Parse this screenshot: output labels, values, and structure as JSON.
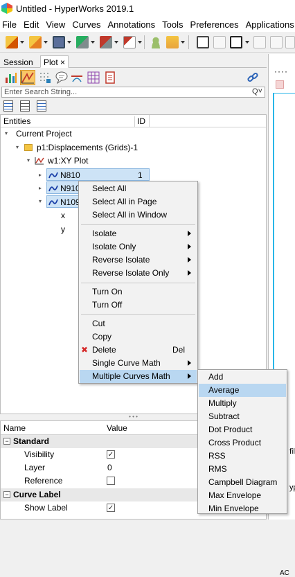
{
  "window": {
    "title": "Untitled - HyperWorks 2019.1"
  },
  "menubar": [
    "File",
    "Edit",
    "View",
    "Curves",
    "Annotations",
    "Tools",
    "Preferences",
    "Applications"
  ],
  "toolbar": {
    "icons": [
      "open-session-icon",
      "open-model-icon",
      "save-icon",
      "export-icon",
      "publish-icon",
      "ppt-export-icon",
      "user-icon",
      "folder-icon",
      "add-page-icon",
      "delete-page-icon",
      "page-layout-icon",
      "window-icon",
      "sync-icon"
    ]
  },
  "panel": {
    "tabs": [
      {
        "label": "Session"
      },
      {
        "label": "Plot"
      }
    ],
    "close_glyph": "×",
    "search_placeholder": "Enter Search String...",
    "search_glyph": "Q˅"
  },
  "entities": {
    "columns": [
      "Entities",
      "ID"
    ],
    "tree": {
      "project": "Current Project",
      "page": "p1:Displacements (Grids)-1",
      "window": "w1:XY Plot",
      "curves": [
        {
          "label": "N810",
          "id": "1"
        },
        {
          "label": "N910",
          "id": ""
        },
        {
          "label": "N109",
          "id": ""
        }
      ],
      "axes": [
        "x",
        "y"
      ]
    }
  },
  "context_menu": {
    "groups": [
      [
        {
          "label": "Select All"
        },
        {
          "label": "Select All in Page"
        },
        {
          "label": "Select All in Window"
        }
      ],
      [
        {
          "label": "Isolate",
          "submenu": true
        },
        {
          "label": "Isolate Only",
          "submenu": true
        },
        {
          "label": "Reverse Isolate",
          "submenu": true
        },
        {
          "label": "Reverse Isolate Only",
          "submenu": true
        }
      ],
      [
        {
          "label": "Turn On"
        },
        {
          "label": "Turn Off"
        }
      ],
      [
        {
          "label": "Cut"
        },
        {
          "label": "Copy"
        },
        {
          "label": "Delete",
          "shortcut": "Del",
          "icon": "✖"
        },
        {
          "label": "Single Curve Math",
          "submenu": true
        },
        {
          "label": "Multiple Curves Math",
          "submenu": true,
          "highlighted": true
        }
      ]
    ]
  },
  "submenu": {
    "items": [
      "Add",
      "Average",
      "Multiply",
      "Subtract",
      "Dot Product",
      "Cross Product",
      "RSS",
      "RMS",
      "Campbell Diagram",
      "Max Envelope",
      "Min Envelope"
    ],
    "highlighted": "Average"
  },
  "splitter_glyph": "• • •",
  "properties": {
    "columns": [
      "Name",
      "Value"
    ],
    "sections": [
      {
        "title": "Standard",
        "rows": [
          {
            "name": "Visibility",
            "type": "checkbox",
            "checked": true,
            "value": "✓"
          },
          {
            "name": "Layer",
            "type": "text",
            "value": "0"
          },
          {
            "name": "Reference",
            "type": "checkbox",
            "checked": false,
            "value": ""
          }
        ]
      },
      {
        "title": "Curve Label",
        "rows": [
          {
            "name": "Show Label",
            "type": "checkbox",
            "checked": true,
            "value": "✓"
          }
        ]
      }
    ],
    "collapse_glyph": "−"
  },
  "right_pane": {
    "dots": "····",
    "fragments": [
      "fil",
      "yp",
      "AC"
    ]
  },
  "colors": {
    "selection": "#b9d7f1",
    "curve": "#1a3fa8",
    "accent": "#2a7fd4"
  }
}
